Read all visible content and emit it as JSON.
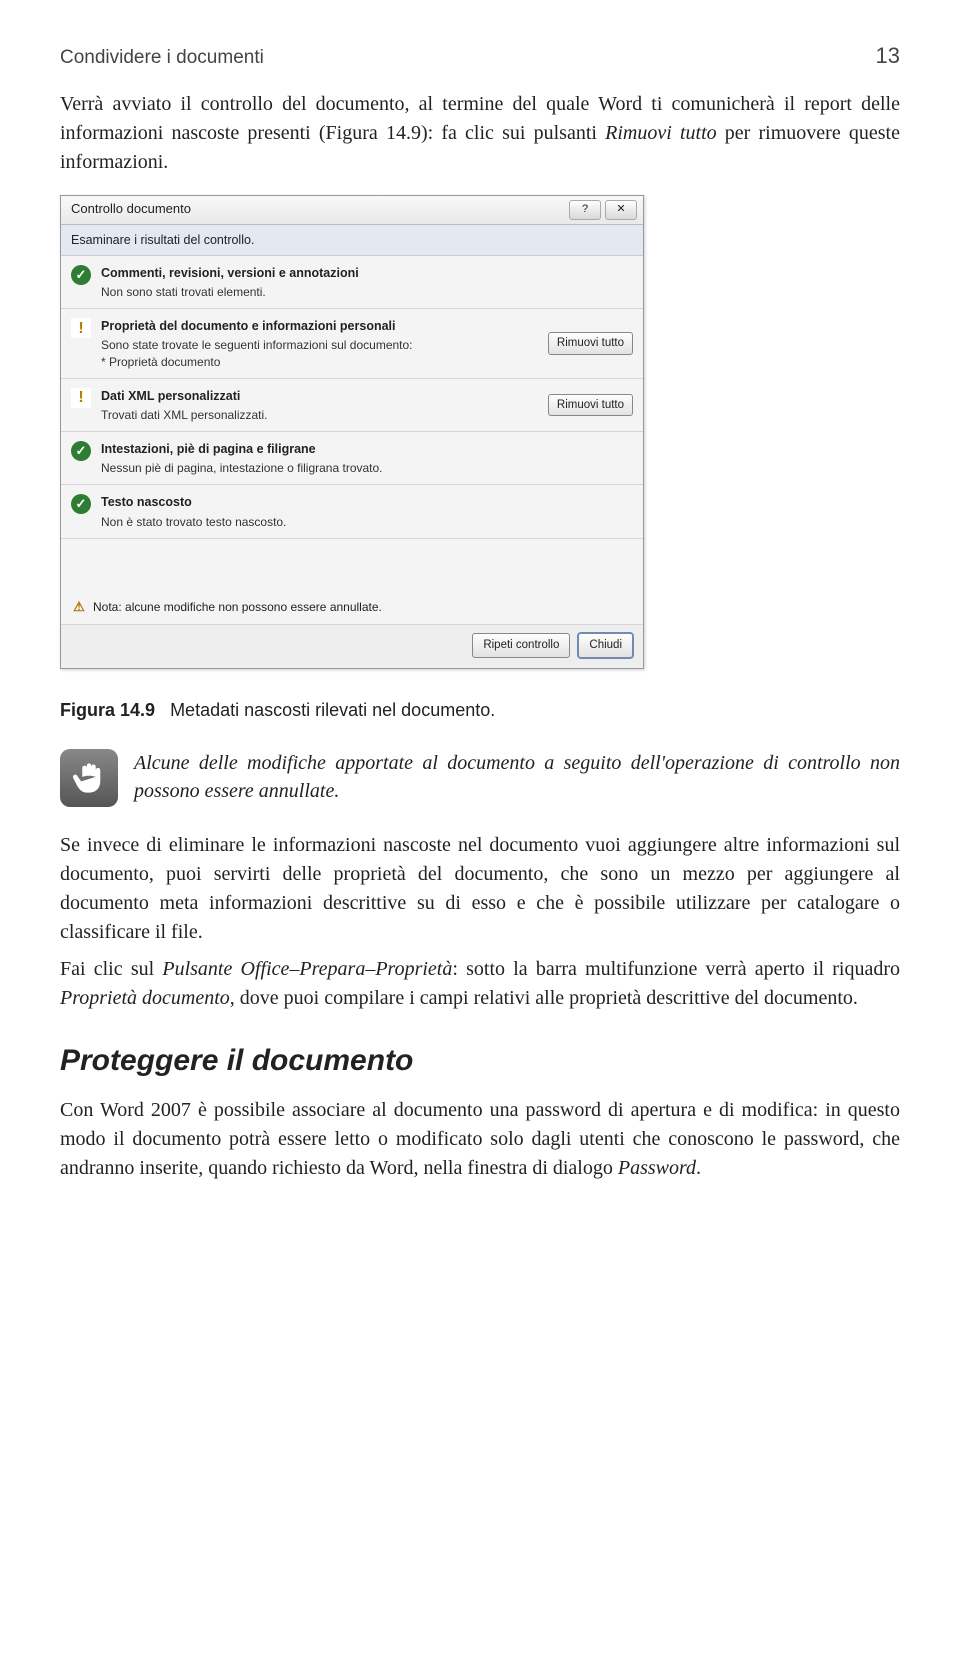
{
  "header": {
    "running_title": "Condividere i documenti",
    "page_number": "13"
  },
  "intro": "Verrà avviato il controllo del documento, al termine del quale Word ti comunicherà il report delle informazioni nascoste presenti (Figura 14.9): fa clic sui pulsanti Rimuovi tutto per rimuovere queste informazioni.",
  "intro_italic": "Rimuovi tutto",
  "dialog": {
    "title": "Controllo documento",
    "subheader": "Esaminare i risultati del controllo.",
    "items": [
      {
        "icon": "check",
        "title": "Commenti, revisioni, versioni e annotazioni",
        "desc": "Non sono stati trovati elementi.",
        "button": null
      },
      {
        "icon": "warn",
        "title": "Proprietà del documento e informazioni personali",
        "desc": "Sono state trovate le seguenti informazioni sul documento:\n* Proprietà documento",
        "button": "Rimuovi tutto"
      },
      {
        "icon": "warn",
        "title": "Dati XML personalizzati",
        "desc": "Trovati dati XML personalizzati.",
        "button": "Rimuovi tutto"
      },
      {
        "icon": "check",
        "title": "Intestazioni, piè di pagina e filigrane",
        "desc": "Nessun piè di pagina, intestazione o filigrana trovato.",
        "button": null
      },
      {
        "icon": "check",
        "title": "Testo nascosto",
        "desc": "Non è stato trovato testo nascosto.",
        "button": null
      }
    ],
    "note": "Nota: alcune modifiche non possono essere annullate.",
    "footer": {
      "repeat": "Ripeti controllo",
      "close": "Chiudi"
    }
  },
  "caption": {
    "label": "Figura 14.9",
    "text": "Metadati nascosti rilevati nel documento."
  },
  "callout": "Alcune delle modifiche apportate al documento a seguito dell'operazione di controllo non possono essere annullate.",
  "para2": "Se invece di eliminare le informazioni nascoste nel documento vuoi aggiungere altre informazioni sul documento, puoi servirti delle proprietà del documento, che sono un mezzo per aggiungere al documento meta informazioni descrittive su di esso e che è possibile utilizzare per catalogare o classificare il file.",
  "para3": "Fai clic sul Pulsante Office–Prepara–Proprietà: sotto la barra multifunzione verrà aperto il riquadro Proprietà documento, dove puoi compilare i campi relativi alle proprietà descrittive del documento.",
  "section_heading": "Proteggere il documento",
  "para4": "Con Word 2007 è possibile associare al documento una password di apertura e di modifica: in questo modo il documento potrà essere letto o modificato solo dagli utenti che conoscono le password, che andranno inserite, quando richiesto da Word, nella finestra di dialogo Password."
}
